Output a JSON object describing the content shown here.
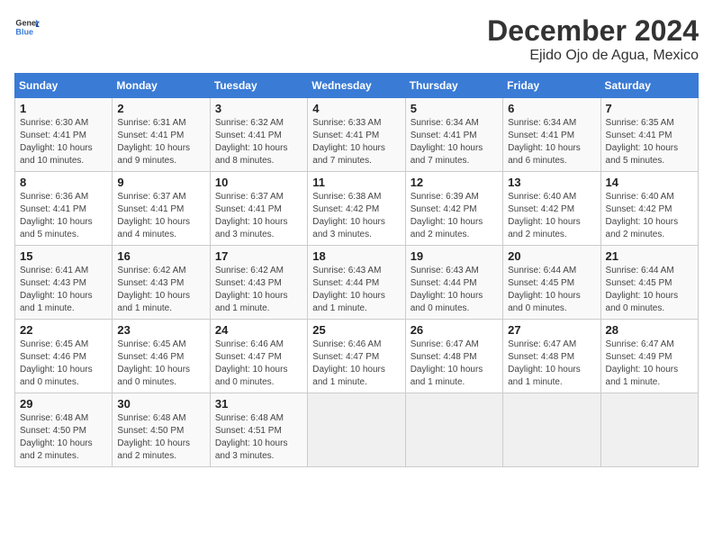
{
  "logo": {
    "text_general": "General",
    "text_blue": "Blue"
  },
  "header": {
    "month": "December 2024",
    "location": "Ejido Ojo de Agua, Mexico"
  },
  "days_of_week": [
    "Sunday",
    "Monday",
    "Tuesday",
    "Wednesday",
    "Thursday",
    "Friday",
    "Saturday"
  ],
  "weeks": [
    [
      {
        "day": "1",
        "sunrise": "6:30 AM",
        "sunset": "4:41 PM",
        "daylight": "10 hours and 10 minutes."
      },
      {
        "day": "2",
        "sunrise": "6:31 AM",
        "sunset": "4:41 PM",
        "daylight": "10 hours and 9 minutes."
      },
      {
        "day": "3",
        "sunrise": "6:32 AM",
        "sunset": "4:41 PM",
        "daylight": "10 hours and 8 minutes."
      },
      {
        "day": "4",
        "sunrise": "6:33 AM",
        "sunset": "4:41 PM",
        "daylight": "10 hours and 7 minutes."
      },
      {
        "day": "5",
        "sunrise": "6:34 AM",
        "sunset": "4:41 PM",
        "daylight": "10 hours and 7 minutes."
      },
      {
        "day": "6",
        "sunrise": "6:34 AM",
        "sunset": "4:41 PM",
        "daylight": "10 hours and 6 minutes."
      },
      {
        "day": "7",
        "sunrise": "6:35 AM",
        "sunset": "4:41 PM",
        "daylight": "10 hours and 5 minutes."
      }
    ],
    [
      {
        "day": "8",
        "sunrise": "6:36 AM",
        "sunset": "4:41 PM",
        "daylight": "10 hours and 5 minutes."
      },
      {
        "day": "9",
        "sunrise": "6:37 AM",
        "sunset": "4:41 PM",
        "daylight": "10 hours and 4 minutes."
      },
      {
        "day": "10",
        "sunrise": "6:37 AM",
        "sunset": "4:41 PM",
        "daylight": "10 hours and 3 minutes."
      },
      {
        "day": "11",
        "sunrise": "6:38 AM",
        "sunset": "4:42 PM",
        "daylight": "10 hours and 3 minutes."
      },
      {
        "day": "12",
        "sunrise": "6:39 AM",
        "sunset": "4:42 PM",
        "daylight": "10 hours and 2 minutes."
      },
      {
        "day": "13",
        "sunrise": "6:40 AM",
        "sunset": "4:42 PM",
        "daylight": "10 hours and 2 minutes."
      },
      {
        "day": "14",
        "sunrise": "6:40 AM",
        "sunset": "4:42 PM",
        "daylight": "10 hours and 2 minutes."
      }
    ],
    [
      {
        "day": "15",
        "sunrise": "6:41 AM",
        "sunset": "4:43 PM",
        "daylight": "10 hours and 1 minute."
      },
      {
        "day": "16",
        "sunrise": "6:42 AM",
        "sunset": "4:43 PM",
        "daylight": "10 hours and 1 minute."
      },
      {
        "day": "17",
        "sunrise": "6:42 AM",
        "sunset": "4:43 PM",
        "daylight": "10 hours and 1 minute."
      },
      {
        "day": "18",
        "sunrise": "6:43 AM",
        "sunset": "4:44 PM",
        "daylight": "10 hours and 1 minute."
      },
      {
        "day": "19",
        "sunrise": "6:43 AM",
        "sunset": "4:44 PM",
        "daylight": "10 hours and 0 minutes."
      },
      {
        "day": "20",
        "sunrise": "6:44 AM",
        "sunset": "4:45 PM",
        "daylight": "10 hours and 0 minutes."
      },
      {
        "day": "21",
        "sunrise": "6:44 AM",
        "sunset": "4:45 PM",
        "daylight": "10 hours and 0 minutes."
      }
    ],
    [
      {
        "day": "22",
        "sunrise": "6:45 AM",
        "sunset": "4:46 PM",
        "daylight": "10 hours and 0 minutes."
      },
      {
        "day": "23",
        "sunrise": "6:45 AM",
        "sunset": "4:46 PM",
        "daylight": "10 hours and 0 minutes."
      },
      {
        "day": "24",
        "sunrise": "6:46 AM",
        "sunset": "4:47 PM",
        "daylight": "10 hours and 0 minutes."
      },
      {
        "day": "25",
        "sunrise": "6:46 AM",
        "sunset": "4:47 PM",
        "daylight": "10 hours and 1 minute."
      },
      {
        "day": "26",
        "sunrise": "6:47 AM",
        "sunset": "4:48 PM",
        "daylight": "10 hours and 1 minute."
      },
      {
        "day": "27",
        "sunrise": "6:47 AM",
        "sunset": "4:48 PM",
        "daylight": "10 hours and 1 minute."
      },
      {
        "day": "28",
        "sunrise": "6:47 AM",
        "sunset": "4:49 PM",
        "daylight": "10 hours and 1 minute."
      }
    ],
    [
      {
        "day": "29",
        "sunrise": "6:48 AM",
        "sunset": "4:50 PM",
        "daylight": "10 hours and 2 minutes."
      },
      {
        "day": "30",
        "sunrise": "6:48 AM",
        "sunset": "4:50 PM",
        "daylight": "10 hours and 2 minutes."
      },
      {
        "day": "31",
        "sunrise": "6:48 AM",
        "sunset": "4:51 PM",
        "daylight": "10 hours and 3 minutes."
      },
      null,
      null,
      null,
      null
    ]
  ]
}
